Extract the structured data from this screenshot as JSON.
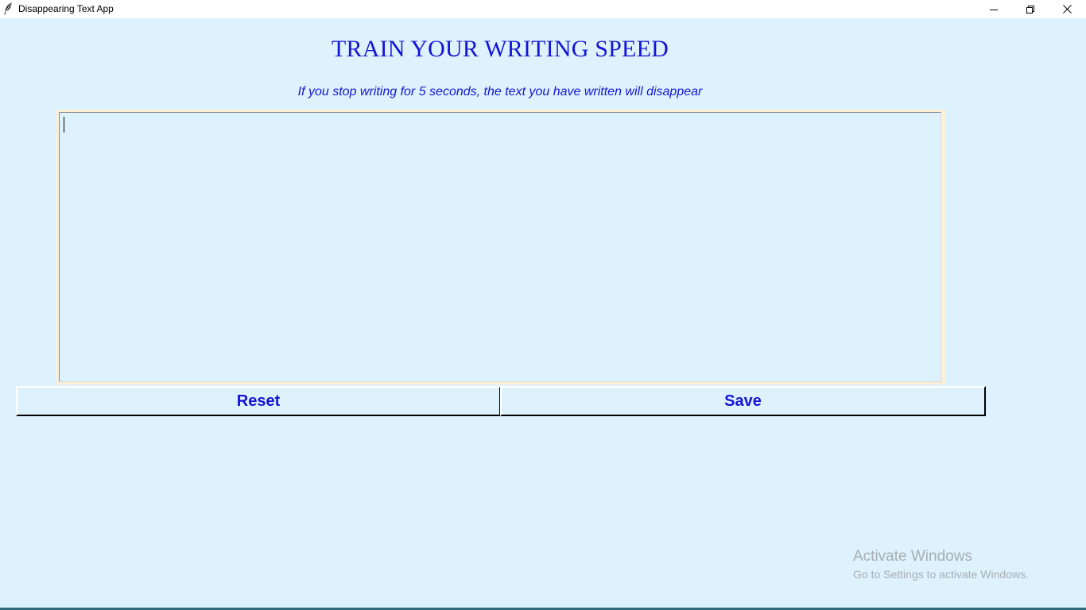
{
  "window": {
    "title": "Disappearing Text App",
    "icon": "feather-icon",
    "controls": [
      "minimize-icon",
      "restore-icon",
      "close-icon"
    ]
  },
  "header": {
    "title": "TRAIN YOUR WRITING SPEED",
    "subtitle": "If you stop writing for 5 seconds, the text you have written will disappear"
  },
  "editor": {
    "value": ""
  },
  "actions": {
    "reset_label": "Reset",
    "save_label": "Save"
  },
  "watermark": {
    "title": "Activate Windows",
    "subtitle": "Go to Settings to activate Windows."
  },
  "colors": {
    "background": "#ddf2fc",
    "text_accent": "#1515d6",
    "frame": "#fdf0d8"
  }
}
